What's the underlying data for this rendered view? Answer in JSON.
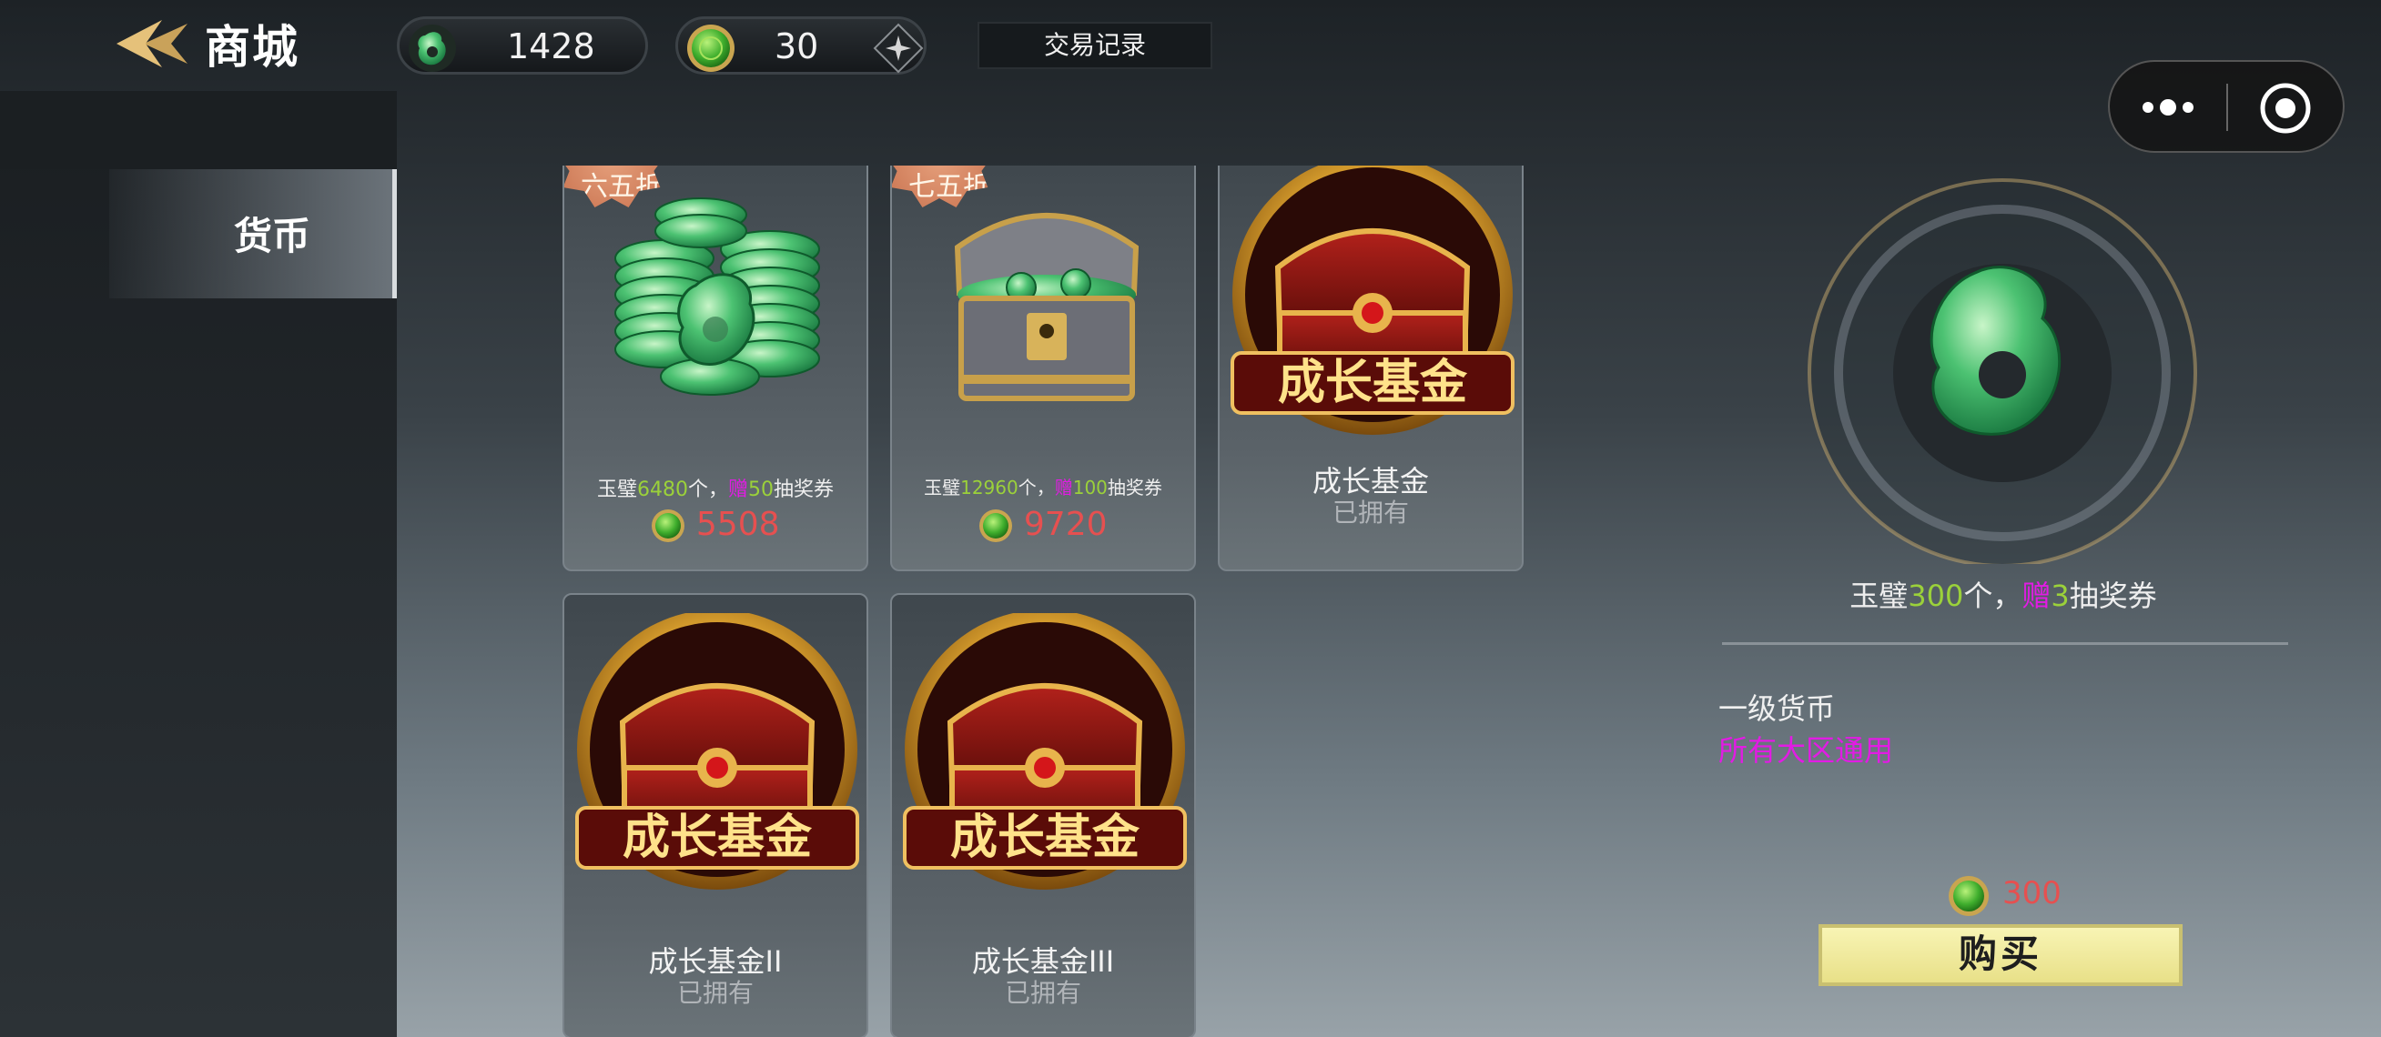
{
  "header": {
    "title": "商城",
    "jade_amount": "1428",
    "coin_amount": "30",
    "trade_record_label": "交易记录"
  },
  "sidebar": {
    "tabs": [
      {
        "label": "货币",
        "selected": true
      }
    ]
  },
  "items": [
    {
      "badge": "六五折",
      "desc_prefix": "玉璧",
      "desc_amount": "6480",
      "desc_mid": "个，",
      "desc_gift": "赠",
      "desc_gift_amount": "50",
      "desc_suffix": "抽奖券",
      "price": "5508"
    },
    {
      "badge": "七五折",
      "desc_prefix": "玉璧",
      "desc_amount": "12960",
      "desc_mid": "个，",
      "desc_gift": "赠",
      "desc_gift_amount": "100",
      "desc_suffix": "抽奖券",
      "price": "9720"
    },
    {
      "name": "成长基金",
      "status": "已拥有",
      "art_text": "成长基金"
    },
    {
      "name": "成长基金II",
      "status": "已拥有",
      "art_text": "成长基金"
    },
    {
      "name": "成长基金III",
      "status": "已拥有",
      "art_text": "成长基金"
    }
  ],
  "detail": {
    "desc_prefix": "玉璧",
    "desc_amount": "300",
    "desc_mid": "个，",
    "desc_gift": "赠",
    "desc_gift_amount": "3",
    "desc_suffix": "抽奖券",
    "type": "一级货币",
    "scope": "所有大区通用",
    "price": "300",
    "buy_label": "购买"
  },
  "colors": {
    "price_red": "#e65050",
    "highlight_green": "#9bd13a",
    "highlight_pink": "#e21be4",
    "buy_button": "#f3eea0"
  }
}
